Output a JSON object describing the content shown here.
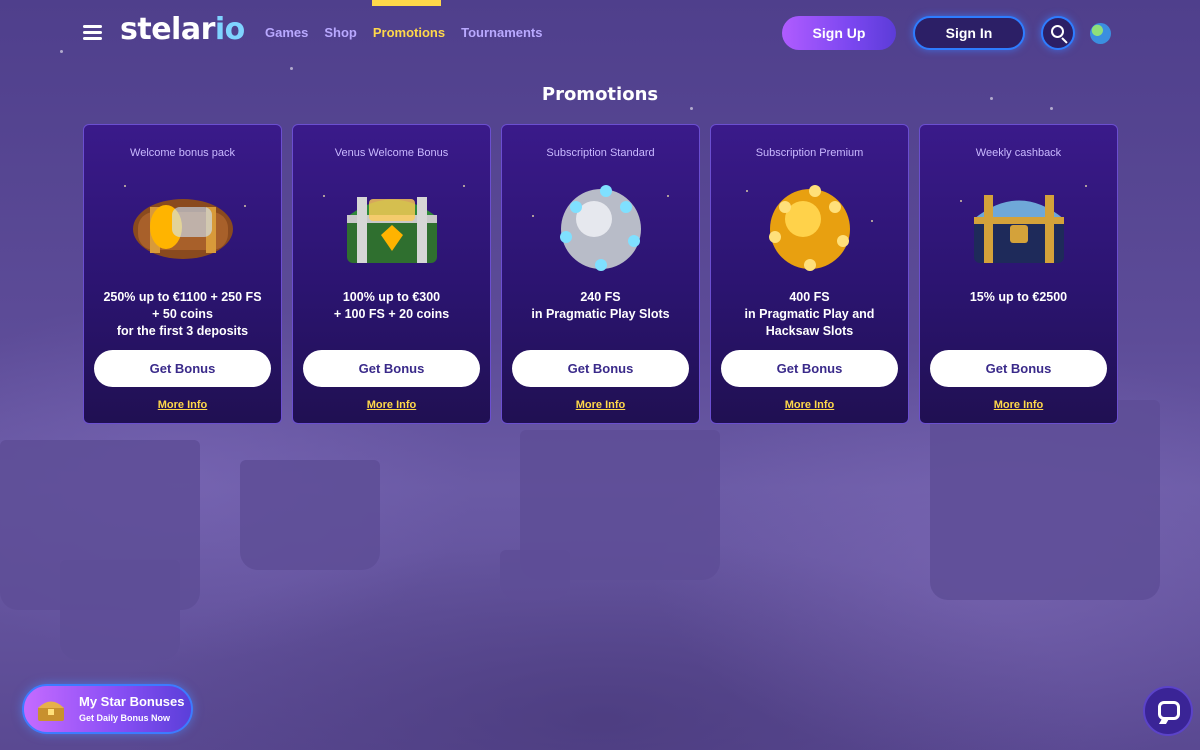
{
  "header": {
    "logo_main": "stelar",
    "logo_accent": "io",
    "nav": [
      {
        "label": "Games",
        "active": false
      },
      {
        "label": "Shop",
        "active": false
      },
      {
        "label": "Promotions",
        "active": true
      },
      {
        "label": "Tournaments",
        "active": false
      }
    ],
    "sign_up_label": "Sign Up",
    "sign_in_label": "Sign In",
    "icons": [
      "menu-icon",
      "search-icon",
      "globe-icon"
    ]
  },
  "page_title": "Promotions",
  "cards": [
    {
      "subtitle": "Welcome bonus pack",
      "image": "wooden-chest-icon",
      "desc": [
        "250% up to €1100 + 250 FS",
        "+ 50 coins",
        "for the first 3 deposits"
      ],
      "button": "Get Bonus",
      "link": "More Info"
    },
    {
      "subtitle": "Venus Welcome Bonus",
      "image": "green-chest-icon",
      "desc": [
        "100% up to €300",
        "+ 100 FS + 20 coins"
      ],
      "button": "Get Bonus",
      "link": "More Info"
    },
    {
      "subtitle": "Subscription Standard",
      "image": "silver-orb-icon",
      "desc": [
        "240 FS",
        "in Pragmatic Play Slots"
      ],
      "button": "Get Bonus",
      "link": "More Info"
    },
    {
      "subtitle": "Subscription Premium",
      "image": "gold-orb-icon",
      "desc": [
        "400 FS",
        "in Pragmatic Play and",
        "Hacksaw Slots"
      ],
      "button": "Get Bonus",
      "link": "More Info"
    },
    {
      "subtitle": "Weekly cashback",
      "image": "blue-chest-icon",
      "desc": [
        "15% up to €2500"
      ],
      "button": "Get Bonus",
      "link": "More Info"
    }
  ],
  "star_bonuses": {
    "title": "My Star Bonuses",
    "subtitle": "Get Daily Bonus Now"
  },
  "colors": {
    "accent_yellow": "#ffd84a",
    "nav_purple": "#b9a9ff",
    "signin_blue": "#2e7cff"
  }
}
